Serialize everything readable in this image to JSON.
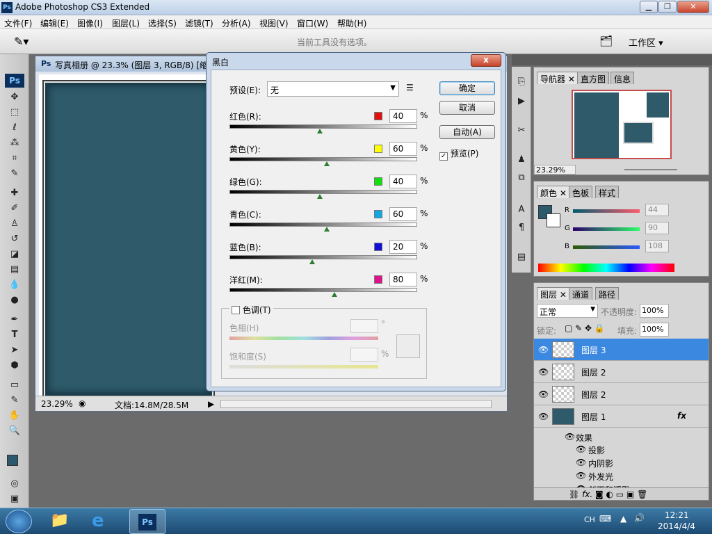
{
  "app": {
    "title": "Adobe Photoshop CS3 Extended",
    "ps_logo": "Ps"
  },
  "menu": [
    "文件(F)",
    "编辑(E)",
    "图像(I)",
    "图层(L)",
    "选择(S)",
    "滤镜(T)",
    "分析(A)",
    "视图(V)",
    "窗口(W)",
    "帮助(H)"
  ],
  "options": {
    "hint": "当前工具没有选项。",
    "workspace": "工作区"
  },
  "document": {
    "title": "写真相册 @ 23.3% (图层 3, RGB/8) [缩",
    "zoom": "23.29%",
    "doc_info": "文档:14.8M/28.5M"
  },
  "dialog": {
    "title": "黑白",
    "close": "x",
    "preset_label": "预设(E):",
    "preset_value": "无",
    "ok": "确定",
    "cancel": "取消",
    "auto": "自动(A)",
    "preview": "预览(P)",
    "percent": "%",
    "sliders": [
      {
        "label": "红色(R):",
        "value": "40",
        "color": "#e01010"
      },
      {
        "label": "黄色(Y):",
        "value": "60",
        "color": "#ffff00"
      },
      {
        "label": "绿色(G):",
        "value": "40",
        "color": "#10e010"
      },
      {
        "label": "青色(C):",
        "value": "60",
        "color": "#10a8e0"
      },
      {
        "label": "蓝色(B):",
        "value": "20",
        "color": "#1010d8"
      },
      {
        "label": "洋红(M):",
        "value": "80",
        "color": "#e0108c"
      }
    ],
    "tint": {
      "label": "色调(T)",
      "hue": "色相(H)",
      "hue_unit": "°",
      "saturation": "饱和度(S)",
      "sat_unit": "%"
    }
  },
  "navigator": {
    "tabs": [
      "导航器",
      "直方图",
      "信息"
    ],
    "zoom": "23.29%"
  },
  "color": {
    "tabs": [
      "颜色",
      "色板",
      "样式"
    ],
    "r_label": "R",
    "g_label": "G",
    "b_label": "B",
    "r": "44",
    "g": "90",
    "b": "108",
    "fg": "#2c5a6c"
  },
  "layers": {
    "tabs": [
      "图层",
      "通道",
      "路径"
    ],
    "blend": "正常",
    "opacity_label": "不透明度:",
    "opacity": "100%",
    "lock_label": "锁定:",
    "fill_label": "填充:",
    "fill": "100%",
    "items": [
      {
        "name": "图层 3"
      },
      {
        "name": "图层 2"
      },
      {
        "name": "图层 2"
      },
      {
        "name": "图层 1"
      }
    ],
    "fx": "fx",
    "effects_label": "效果",
    "effects": [
      "投影",
      "内阴影",
      "外发光",
      "斜面和浮雕"
    ]
  },
  "taskbar": {
    "lang": "CH",
    "time": "12:21",
    "date": "2014/4/4",
    "ps": "Ps"
  }
}
